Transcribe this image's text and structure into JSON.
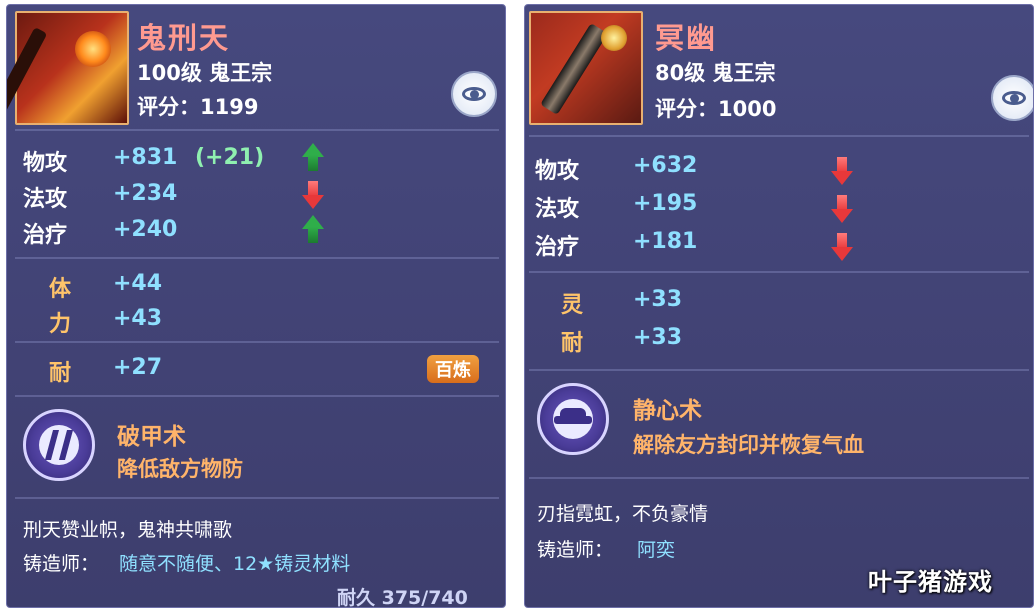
{
  "left": {
    "name": "鬼刑天",
    "level": "100级  鬼王宗",
    "score": "评分：1199",
    "stats": [
      {
        "label": "物攻",
        "value": "+831",
        "bonus": "(+21)",
        "trend": "up"
      },
      {
        "label": "法攻",
        "value": "+234",
        "bonus": "",
        "trend": "down"
      },
      {
        "label": "治疗",
        "value": "+240",
        "bonus": "",
        "trend": "up"
      }
    ],
    "attrs": [
      {
        "label": "体",
        "value": "+44"
      },
      {
        "label": "力",
        "value": "+43"
      },
      {
        "label": "耐",
        "value": "+27"
      }
    ],
    "badge": "百炼",
    "skill": {
      "name": "破甲术",
      "desc": "降低敌方物防"
    },
    "flavor": "刑天赞业帜，鬼神共啸歌",
    "smith_label": "铸造师：",
    "smith_value": "随意不随便、12★铸灵材料",
    "durability": "耐久 375/740"
  },
  "right": {
    "name": "冥幽",
    "level": "80级  鬼王宗",
    "score": "评分：1000",
    "stats": [
      {
        "label": "物攻",
        "value": "+632",
        "trend": "down"
      },
      {
        "label": "法攻",
        "value": "+195",
        "trend": "down"
      },
      {
        "label": "治疗",
        "value": "+181",
        "trend": "down"
      }
    ],
    "attrs": [
      {
        "label": "灵",
        "value": "+33"
      },
      {
        "label": "耐",
        "value": "+33"
      }
    ],
    "skill": {
      "name": "静心术",
      "desc": "解除友方封印并恢复气血"
    },
    "flavor": "刃指霓虹，不负豪情",
    "smith_label": "铸造师：",
    "smith_value": "阿奕"
  },
  "watermark": "叶子猪游戏",
  "icons": {
    "eye": "eye-icon",
    "arrow_up": "arrow-up-icon",
    "arrow_down": "arrow-down-icon",
    "skill_left": "break-armor-skill-icon",
    "skill_right": "calm-mind-skill-icon"
  },
  "colors": {
    "panel": "#44467a",
    "name": "#ff9a90",
    "value": "#8fe0ff",
    "attr_label": "#ffc46a",
    "skill": "#ffb46a",
    "arrow_up": "#2fae4a",
    "arrow_down": "#e8383a",
    "badge": "#e0822a"
  }
}
